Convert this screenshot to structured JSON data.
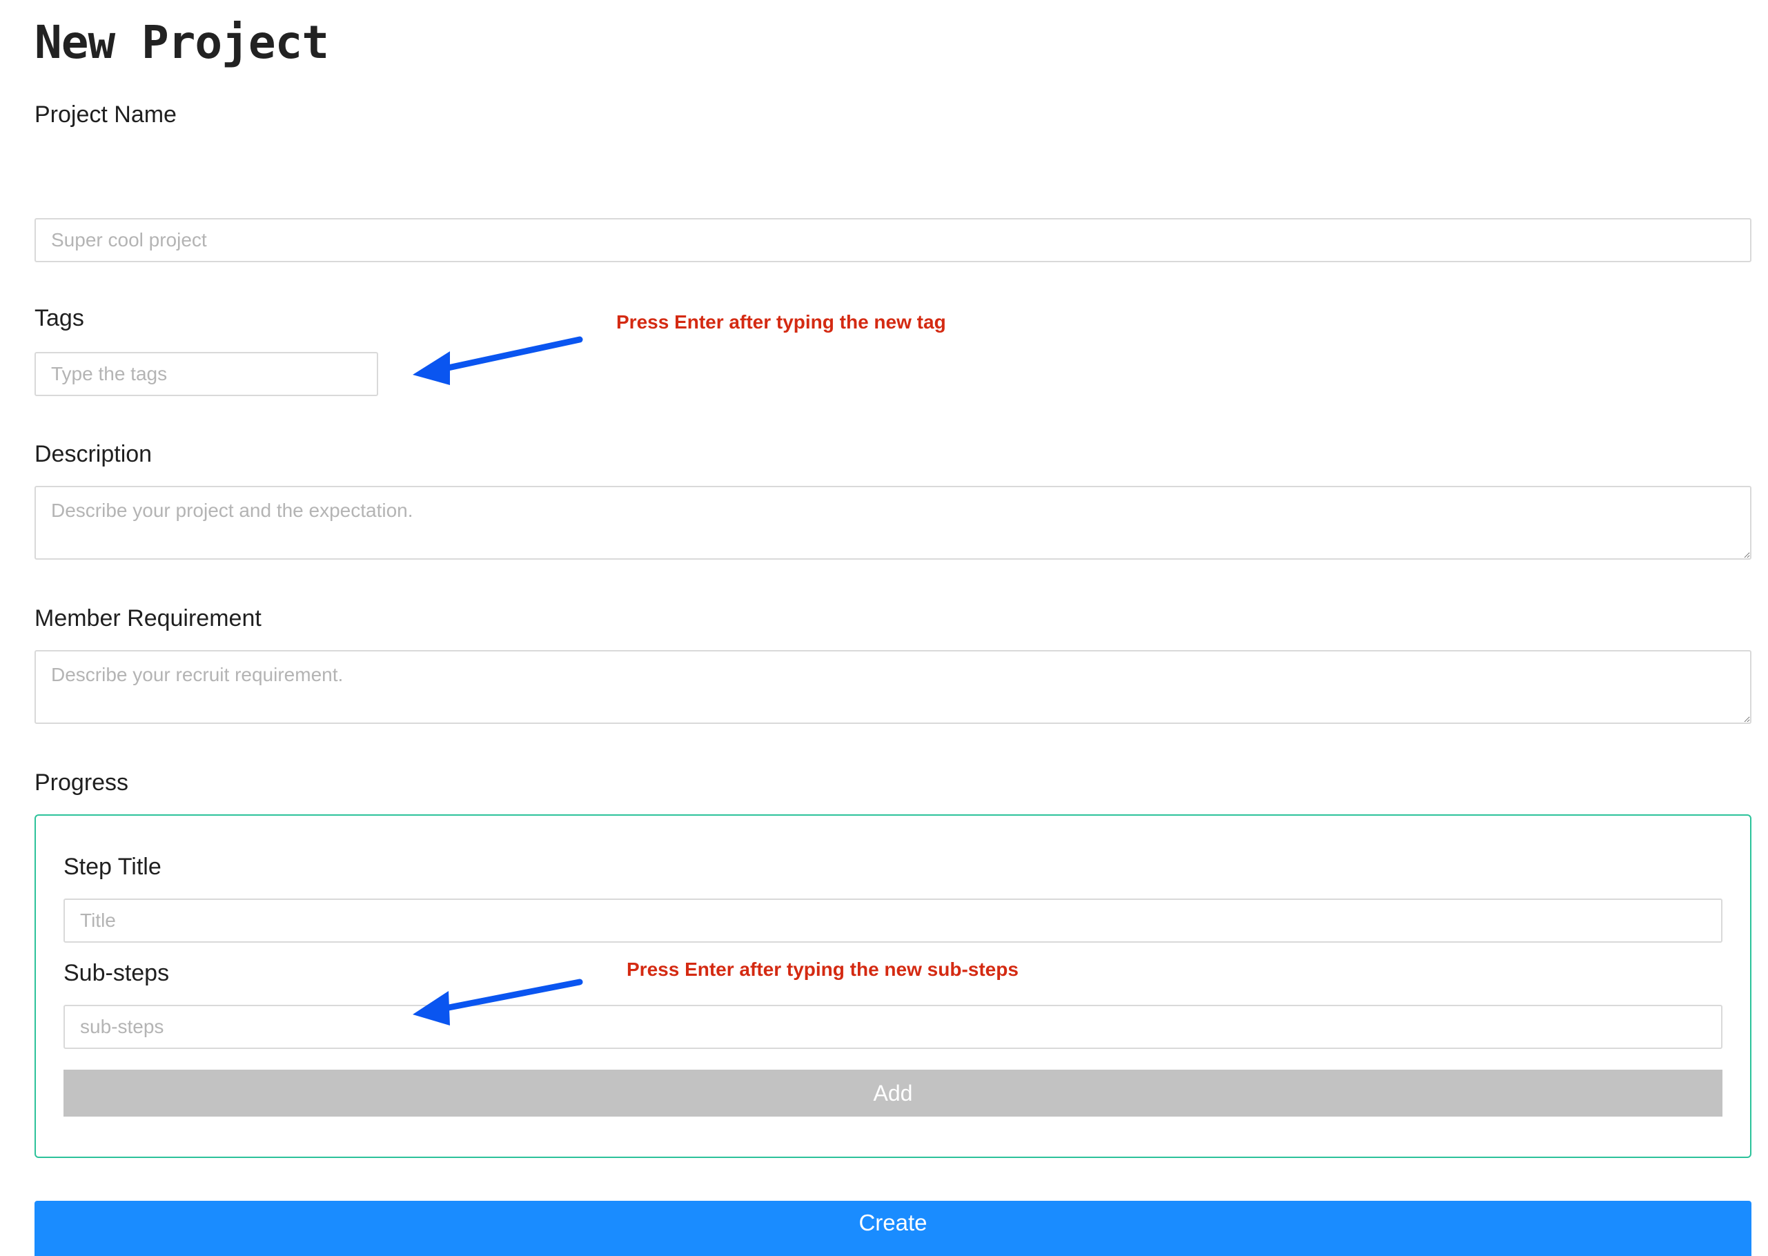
{
  "page": {
    "title": "New Project"
  },
  "form": {
    "project_name": {
      "label": "Project Name",
      "placeholder": "Super cool project",
      "value": ""
    },
    "tags": {
      "label": "Tags",
      "placeholder": "Type the tags",
      "value": ""
    },
    "description": {
      "label": "Description",
      "placeholder": "Describe your project and the expectation.",
      "value": ""
    },
    "member_requirement": {
      "label": "Member Requirement",
      "placeholder": "Describe your recruit requirement.",
      "value": ""
    },
    "progress": {
      "label": "Progress",
      "step_title": {
        "label": "Step Title",
        "placeholder": "Title",
        "value": ""
      },
      "sub_steps": {
        "label": "Sub-steps",
        "placeholder": "sub-steps",
        "value": ""
      },
      "add_label": "Add"
    },
    "create_label": "Create"
  },
  "annotations": {
    "tags_hint": "Press Enter after typing the new tag",
    "sub_steps_hint": "Press Enter after typing the new sub-steps"
  },
  "colors": {
    "primary_button": "#1a8cff",
    "disabled_button": "#c2c2c2",
    "progress_border": "#2cc29a",
    "hint_text": "#d42a12",
    "arrow": "#0a55f0"
  },
  "icons": {
    "annotation_arrow": "arrow-left-icon"
  }
}
